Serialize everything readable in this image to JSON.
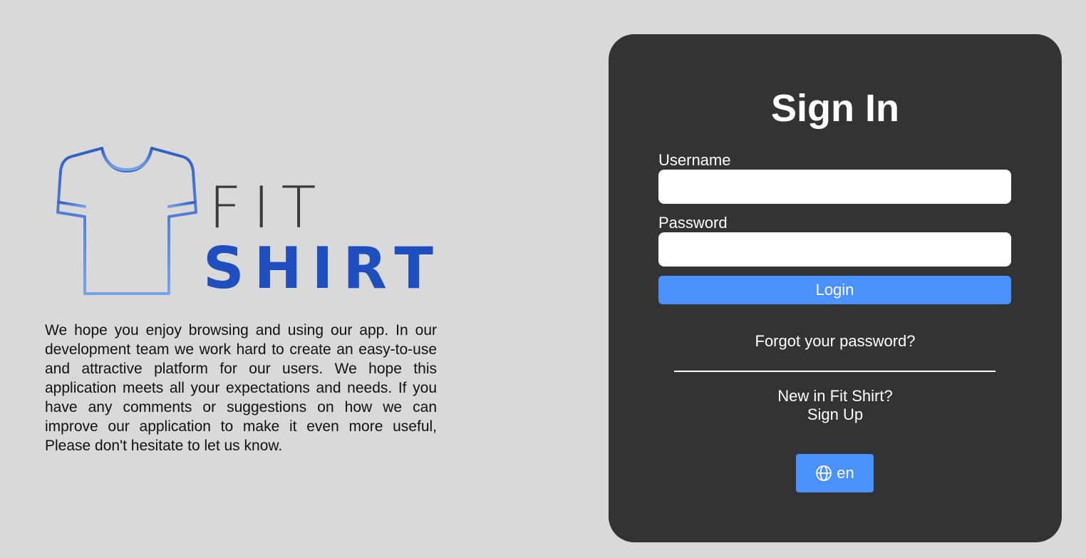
{
  "brand": {
    "logo_word_1": "FIT",
    "logo_word_2": "SHIRT",
    "intro_text": "We hope you enjoy browsing and using our app. In our development team we work hard to create an easy-to-use and attractive platform for our users. We hope this application meets all your expectations and needs. If you have any comments or suggestions on how we can improve our application to make it even more useful, Please don't hesitate to let us know.",
    "logo_icon": "t-shirt-icon",
    "logo_color": "#1f4fbf"
  },
  "signin": {
    "title": "Sign In",
    "username_label": "Username",
    "username_value": "",
    "username_placeholder": "",
    "password_label": "Password",
    "password_value": "",
    "password_placeholder": "",
    "login_label": "Login",
    "forgot_label": "Forgot your password?",
    "new_text": "New in Fit Shirt?",
    "signup_label": "Sign Up",
    "language_label": "en",
    "language_icon": "globe-icon"
  },
  "colors": {
    "background": "#d9d9d9",
    "card": "#333333",
    "accent": "#4b91fb"
  }
}
